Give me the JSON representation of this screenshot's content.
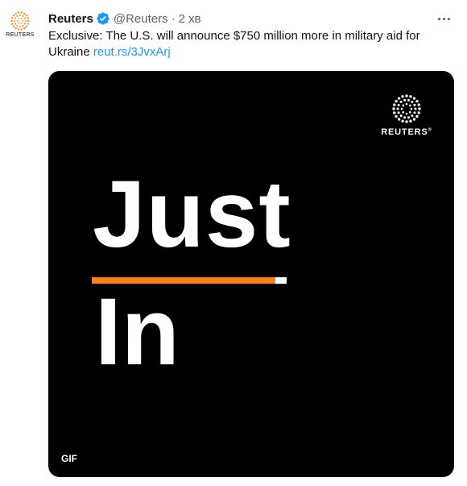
{
  "tweet": {
    "avatar_label": "REUTERS",
    "author_name": "Reuters",
    "handle": "@Reuters",
    "separator": "·",
    "time": "2 хв",
    "text": "Exclusive: The U.S. will announce $750 million more in military aid for Ukraine ",
    "link": "reut.rs/3JvxArj"
  },
  "media": {
    "logo_text": "REUTERS",
    "logo_mark": "®",
    "headline_top": "Just",
    "headline_bottom": "In",
    "badge": "GIF",
    "colors": {
      "background": "#000000",
      "accent_bar": "#f5821f",
      "text": "#ffffff"
    }
  },
  "icons": {
    "verified": "verified-badge-icon",
    "more": "more-options-icon",
    "avatar": "reuters-logo-icon"
  },
  "colors": {
    "link": "#1d9bf0",
    "secondary_text": "#536471",
    "verified": "#1d9bf0"
  }
}
